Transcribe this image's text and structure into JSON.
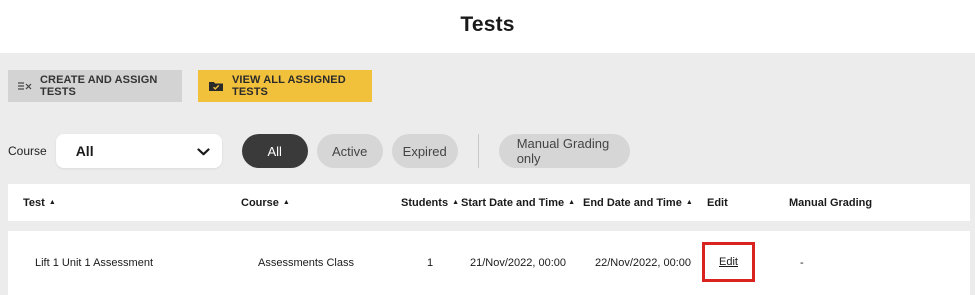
{
  "page": {
    "title": "Tests"
  },
  "toolbar": {
    "create_label": "CREATE AND ASSIGN TESTS",
    "create_icon": "list-check-icon",
    "view_label": "VIEW ALL ASSIGNED TESTS",
    "view_icon": "folder-check-icon",
    "accent_color": "#f2c13c"
  },
  "filters": {
    "course_label": "Course",
    "course_selected": "All",
    "status_pills": [
      {
        "label": "All",
        "selected": true
      },
      {
        "label": "Active",
        "selected": false
      },
      {
        "label": "Expired",
        "selected": false
      }
    ],
    "manual_grading_label": "Manual Grading only"
  },
  "table": {
    "columns": [
      {
        "label": "Test",
        "sortable": true
      },
      {
        "label": "Course",
        "sortable": true
      },
      {
        "label": "Students",
        "sortable": true
      },
      {
        "label": "Start Date and Time",
        "sortable": true
      },
      {
        "label": "End Date and Time",
        "sortable": true
      },
      {
        "label": "Edit",
        "sortable": false
      },
      {
        "label": "Manual Grading",
        "sortable": false
      }
    ],
    "sort_arrow": "▲",
    "rows": [
      {
        "test": "Lift 1 Unit 1 Assessment",
        "course": "Assessments Class",
        "students": "1",
        "start": "21/Nov/2022, 00:00",
        "end": "22/Nov/2022, 00:00",
        "edit": "Edit",
        "manual_grading": "-"
      }
    ]
  },
  "highlight_color": "#d8231f"
}
